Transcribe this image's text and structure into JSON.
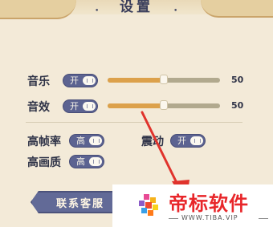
{
  "panel": {
    "title": "设置"
  },
  "settings": {
    "music": {
      "label": "音乐",
      "toggle": "开",
      "value": "50",
      "level": 0.5
    },
    "sfx": {
      "label": "音效",
      "toggle": "开",
      "value": "50",
      "level": 0.5
    },
    "high_fps": {
      "label": "高帧率",
      "toggle": "高"
    },
    "vibration": {
      "label": "震动",
      "toggle": "开"
    },
    "hd_quality": {
      "label": "高画质",
      "toggle": "高"
    }
  },
  "contact_button": {
    "label": "联系客服"
  },
  "watermark": {
    "brand": "帝标软件",
    "url": "WWW.TIBA.VIP",
    "logo_icon": "cube-logo-icon"
  },
  "colors": {
    "toggle": "#5c6391",
    "slider_fill": "#dca14b",
    "arrow": "#e0332c",
    "background": "#f3ead8"
  }
}
